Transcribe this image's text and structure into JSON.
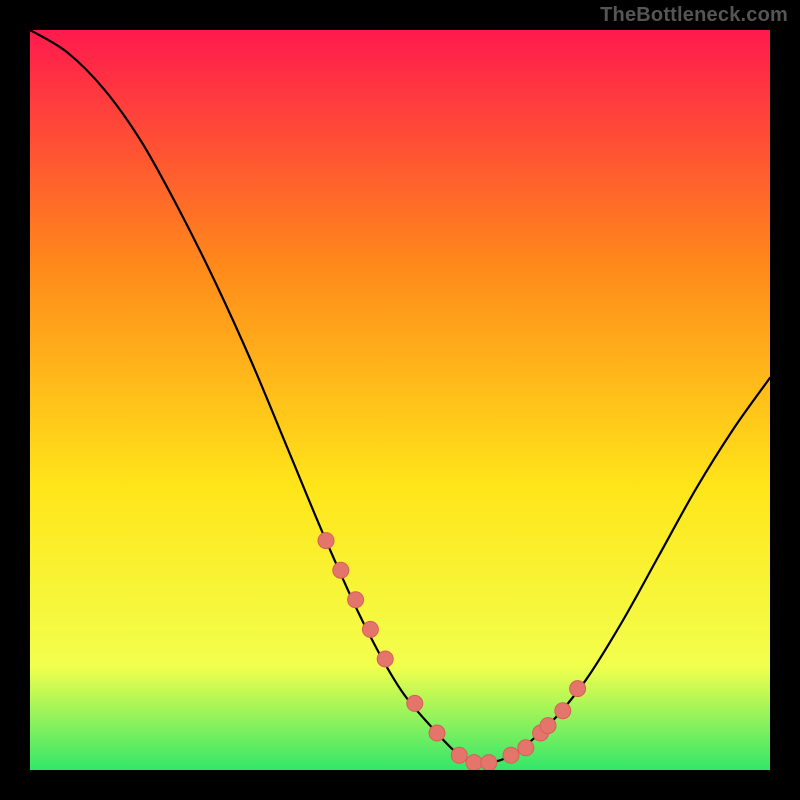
{
  "watermark": "TheBottleneck.com",
  "colors": {
    "frame": "#000000",
    "gradient_top": "#ff1a4d",
    "gradient_mid1": "#ff8a1a",
    "gradient_mid2": "#ffe61a",
    "gradient_mid3": "#f2ff4d",
    "gradient_bottom": "#33e66a",
    "curve": "#000000",
    "marker_fill": "#e3756b",
    "marker_stroke": "#d85f57"
  },
  "chart_data": {
    "type": "line",
    "title": "",
    "xlabel": "",
    "ylabel": "",
    "xlim": [
      0,
      100
    ],
    "ylim": [
      0,
      100
    ],
    "series": [
      {
        "name": "bottleneck-curve",
        "x": [
          0,
          5,
          10,
          15,
          20,
          25,
          30,
          35,
          40,
          45,
          50,
          55,
          58,
          60,
          62,
          65,
          70,
          75,
          80,
          85,
          90,
          95,
          100
        ],
        "y": [
          100,
          97,
          92,
          85,
          76,
          66,
          55,
          43,
          31,
          20,
          11,
          5,
          2,
          1,
          1,
          2,
          6,
          12,
          20,
          29,
          38,
          46,
          53
        ]
      }
    ],
    "markers": {
      "name": "highlighted-points",
      "x": [
        40,
        42,
        44,
        46,
        48,
        52,
        55,
        58,
        60,
        62,
        65,
        67,
        69,
        70,
        72,
        74
      ],
      "y": [
        31,
        27,
        23,
        19,
        15,
        9,
        5,
        2,
        1,
        1,
        2,
        3,
        5,
        6,
        8,
        11
      ]
    }
  }
}
